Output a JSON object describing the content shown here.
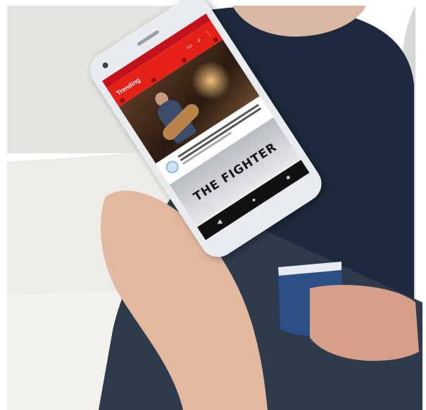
{
  "phone": {
    "app_bar_title": "Trending",
    "app_bar_icons": {
      "cast": "cast-icon",
      "search": "search-icon",
      "more": "more-vert-icon"
    },
    "video_poster_title": "THE FIGHTER",
    "nav_icons": {
      "back": "◀",
      "home": "●",
      "recents": "■"
    }
  },
  "colors": {
    "youtube_red": "#e62117",
    "status_bar": "#c4121c",
    "nav_bar": "#111111"
  }
}
